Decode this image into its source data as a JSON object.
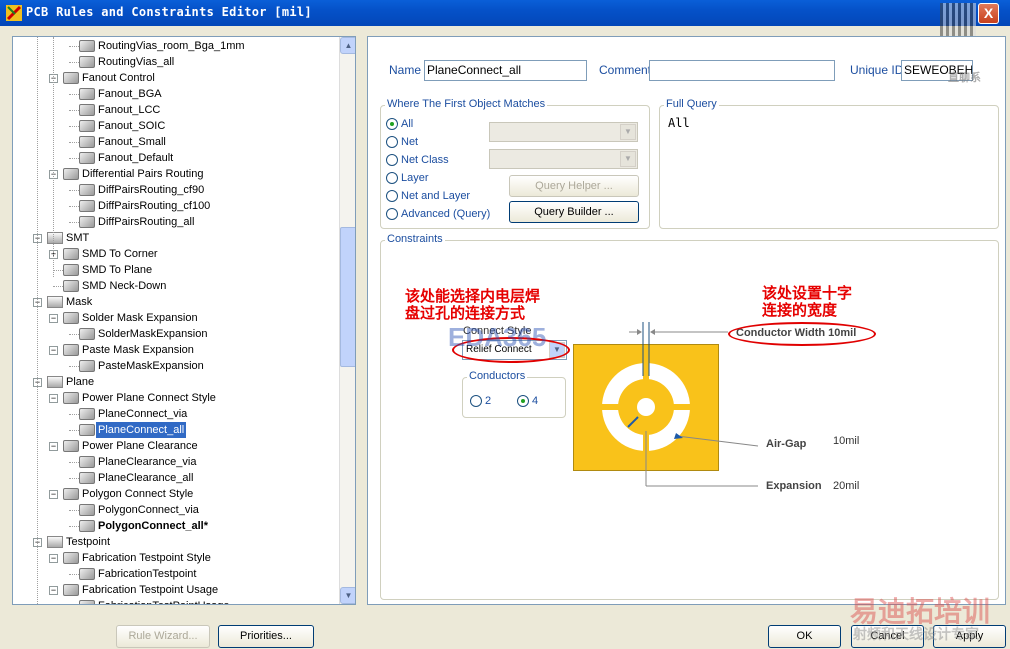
{
  "window": {
    "title": "PCB Rules and Constraints Editor [mil]",
    "close_glyph": "X"
  },
  "tree": {
    "rows": [
      {
        "label": "RoutingVias_room_Bga_1mm",
        "level": 3
      },
      {
        "label": "RoutingVias_all",
        "level": 3
      },
      {
        "label": "Fanout Control",
        "level": 2,
        "expander": "−"
      },
      {
        "label": "Fanout_BGA",
        "level": 3
      },
      {
        "label": "Fanout_LCC",
        "level": 3
      },
      {
        "label": "Fanout_SOIC",
        "level": 3
      },
      {
        "label": "Fanout_Small",
        "level": 3
      },
      {
        "label": "Fanout_Default",
        "level": 3
      },
      {
        "label": "Differential Pairs Routing",
        "level": 2,
        "expander": "−"
      },
      {
        "label": "DiffPairsRouting_cf90",
        "level": 3
      },
      {
        "label": "DiffPairsRouting_cf100",
        "level": 3
      },
      {
        "label": "DiffPairsRouting_all",
        "level": 3
      },
      {
        "label": "SMT",
        "level": 1,
        "expander": "−"
      },
      {
        "label": "SMD To Corner",
        "level": 2,
        "expander": "+"
      },
      {
        "label": "SMD To Plane",
        "level": 2
      },
      {
        "label": "SMD Neck-Down",
        "level": 2
      },
      {
        "label": "Mask",
        "level": 1,
        "expander": "−"
      },
      {
        "label": "Solder Mask Expansion",
        "level": 2,
        "expander": "−"
      },
      {
        "label": "SolderMaskExpansion",
        "level": 3
      },
      {
        "label": "Paste Mask Expansion",
        "level": 2,
        "expander": "−"
      },
      {
        "label": "PasteMaskExpansion",
        "level": 3
      },
      {
        "label": "Plane",
        "level": 1,
        "expander": "−"
      },
      {
        "label": "Power Plane Connect Style",
        "level": 2,
        "expander": "−"
      },
      {
        "label": "PlaneConnect_via",
        "level": 3
      },
      {
        "label": "PlaneConnect_all",
        "level": 3,
        "selected": true
      },
      {
        "label": "Power Plane Clearance",
        "level": 2,
        "expander": "−"
      },
      {
        "label": "PlaneClearance_via",
        "level": 3
      },
      {
        "label": "PlaneClearance_all",
        "level": 3
      },
      {
        "label": "Polygon Connect Style",
        "level": 2,
        "expander": "−"
      },
      {
        "label": "PolygonConnect_via",
        "level": 3
      },
      {
        "label": "PolygonConnect_all*",
        "level": 3,
        "bold": true
      },
      {
        "label": "Testpoint",
        "level": 1,
        "expander": "−"
      },
      {
        "label": "Fabrication Testpoint Style",
        "level": 2,
        "expander": "−"
      },
      {
        "label": "FabricationTestpoint",
        "level": 3
      },
      {
        "label": "Fabrication Testpoint Usage",
        "level": 2,
        "expander": "−"
      },
      {
        "label": "FabricationTestPointUsage",
        "level": 3
      }
    ]
  },
  "rule": {
    "name_label": "Name",
    "name_value": "PlaneConnect_all",
    "comment_label": "Comment",
    "comment_value": "",
    "uid_label": "Unique ID",
    "uid_value": "SEWEOBEH"
  },
  "first_object": {
    "title": "Where The First Object Matches",
    "options": [
      "All",
      "Net",
      "Net Class",
      "Layer",
      "Net and Layer",
      "Advanced (Query)"
    ],
    "selected": "All",
    "query_helper": "Query Helper ...",
    "query_builder": "Query Builder ..."
  },
  "full_query": {
    "title": "Full Query",
    "text": "All"
  },
  "constraints": {
    "title": "Constraints",
    "connect_style_label": "Connect Style",
    "connect_style_value": "Relief Connect",
    "conductors_label": "Conductors",
    "conductor_options": [
      "2",
      "4"
    ],
    "conductors_selected": "4",
    "conductor_width": "Conductor Width 10mil",
    "air_gap_label": "Air-Gap",
    "air_gap_value": "10mil",
    "expansion_label": "Expansion",
    "expansion_value": "20mil"
  },
  "annotations": {
    "left_line1": "该处能选择内电层焊",
    "left_line2": "盘过孔的连接方式",
    "right_line1": "该处设置十字",
    "right_line2": "连接的宽度",
    "colors": {
      "annotation": "#e60000"
    }
  },
  "watermarks": {
    "eda": "EDA365",
    "brand": "易迪拓培训",
    "brand_sub": "射频和天线设计专家",
    "qr_caption": "直聊系"
  },
  "footer": {
    "rule_wizard": "Rule Wizard...",
    "priorities": "Priorities...",
    "ok": "OK",
    "cancel": "Cancel",
    "apply": "Apply"
  }
}
